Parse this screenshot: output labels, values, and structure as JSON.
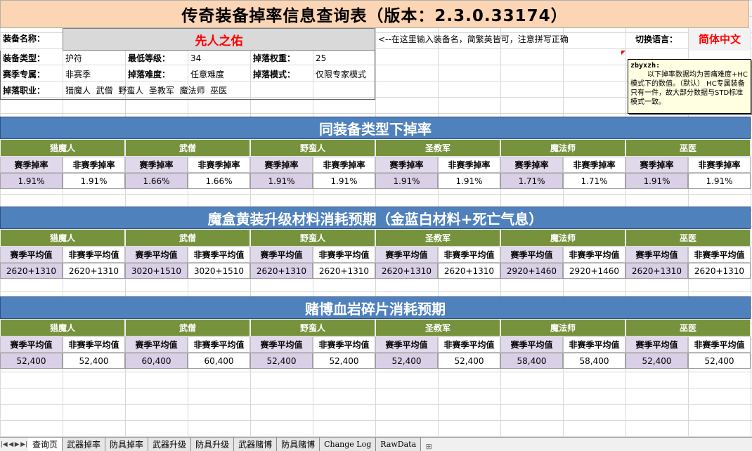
{
  "title": "传奇装备掉率信息查询表（版本：2.3.0.33174）",
  "info": {
    "name_label": "装备名称：",
    "name_value": "先人之佑",
    "hint": "<--在这里输入装备名，简繁英皆可，注意拼写正确",
    "lang_label": "切换语言：",
    "lang_value": "简体中文",
    "type_label": "装备类型：",
    "type_value": "护符",
    "minlevel_label": "最低等级：",
    "minlevel_value": "34",
    "weight_label": "掉落权重：",
    "weight_value": "25",
    "season_label": "赛季专属：",
    "season_value": "非赛季",
    "difficulty_label": "掉落难度：",
    "difficulty_value": "任意难度",
    "mode_label": "掉落模式：",
    "mode_value": "仅限专家模式",
    "class_label": "掉落职业：",
    "class_value": "猎魔人  武僧  野蛮人  圣教军  魔法师  巫医"
  },
  "comment": {
    "author": "zbyxzh:",
    "body": "以下掉率数据均为苦痛难度+HC模式下的数值。（默认） HC专属装备只有一件，故大部分数据与STD标准模式一致。"
  },
  "classes": [
    "猎魔人",
    "武僧",
    "野蛮人",
    "圣教军",
    "魔法师",
    "巫医"
  ],
  "drop": {
    "title": "同装备类型下掉率",
    "season_col": "赛季掉率",
    "nonseason_col": "非赛季掉率",
    "values": [
      [
        "1.91%",
        "1.91%"
      ],
      [
        "1.66%",
        "1.66%"
      ],
      [
        "1.91%",
        "1.91%"
      ],
      [
        "1.91%",
        "1.91%"
      ],
      [
        "1.71%",
        "1.71%"
      ],
      [
        "1.91%",
        "1.91%"
      ]
    ]
  },
  "cube": {
    "title": "魔盒黄装升级材料消耗预期（金蓝白材料+死亡气息）",
    "season_col": "赛季平均值",
    "nonseason_col": "非赛季平均值",
    "values": [
      [
        "2620+1310",
        "2620+1310"
      ],
      [
        "3020+1510",
        "3020+1510"
      ],
      [
        "2620+1310",
        "2620+1310"
      ],
      [
        "2620+1310",
        "2620+1310"
      ],
      [
        "2920+1460",
        "2920+1460"
      ],
      [
        "2620+1310",
        "2620+1310"
      ]
    ]
  },
  "gamble": {
    "title": "赌博血岩碎片消耗预期",
    "season_col": "赛季平均值",
    "nonseason_col": "非赛季平均值",
    "values": [
      [
        "52,400",
        "52,400"
      ],
      [
        "60,400",
        "60,400"
      ],
      [
        "52,400",
        "52,400"
      ],
      [
        "52,400",
        "52,400"
      ],
      [
        "58,400",
        "58,400"
      ],
      [
        "52,400",
        "52,400"
      ]
    ]
  },
  "tabs": [
    {
      "label": "查询页",
      "active": true
    },
    {
      "label": "武器掉率"
    },
    {
      "label": "防具掉率"
    },
    {
      "label": "武器升级"
    },
    {
      "label": "防具升级"
    },
    {
      "label": "武器赌博"
    },
    {
      "label": "防具赌博"
    },
    {
      "label": "Change Log",
      "mono": true
    },
    {
      "label": "RawData",
      "mono": true
    }
  ]
}
